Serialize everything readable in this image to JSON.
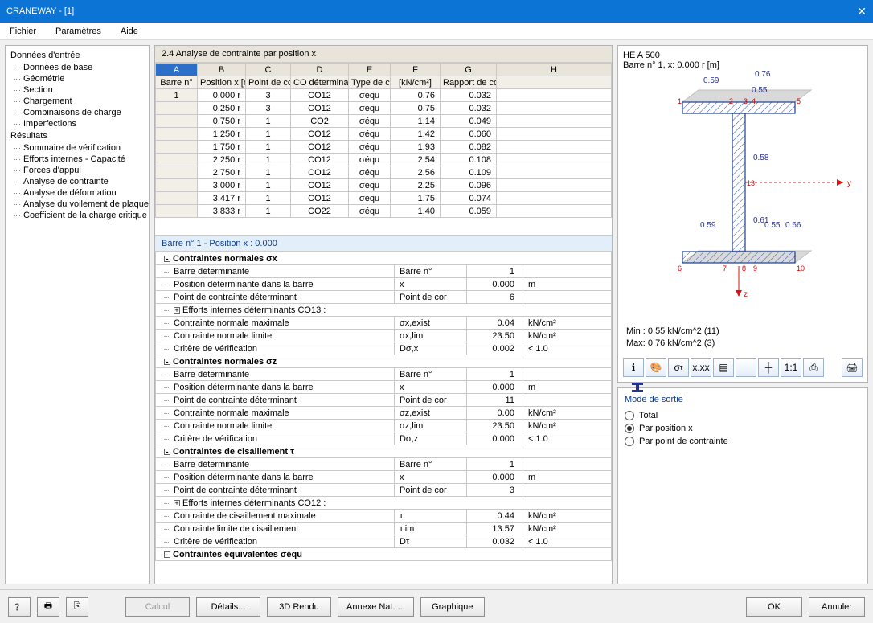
{
  "window": {
    "title": "CRANEWAY - [1]"
  },
  "menu": {
    "file": "Fichier",
    "params": "Paramètres",
    "help": "Aide"
  },
  "nav": {
    "cat_input": "Données d'entrée",
    "input_items": [
      "Données de base",
      "Géométrie",
      "Section",
      "Chargement",
      "Combinaisons de charge",
      "Imperfections"
    ],
    "cat_results": "Résultats",
    "result_items": [
      "Sommaire de vérification",
      "Efforts internes - Capacité",
      "Forces d'appui",
      "Analyse de contrainte",
      "Analyse de déformation",
      "Analyse du voilement de plaque",
      "Coefficient de la charge critique"
    ]
  },
  "panel": {
    "title": "2.4 Analyse de contrainte par position x"
  },
  "grid": {
    "letters": [
      "A",
      "B",
      "C",
      "D",
      "E",
      "F",
      "G",
      "H"
    ],
    "headers": [
      "Barre n°",
      "Position x [m]",
      "Point de contrainte",
      "CO déterminante",
      "Type de contrai",
      "[kN/cm²]",
      "Rapport de contraint",
      ""
    ],
    "rows": [
      {
        "a": "1",
        "b": "0.000 r",
        "c": "3",
        "d": "CO12",
        "e": "σéqu",
        "f": "0.76",
        "g": "0.032"
      },
      {
        "a": "",
        "b": "0.250 r",
        "c": "3",
        "d": "CO12",
        "e": "σéqu",
        "f": "0.75",
        "g": "0.032"
      },
      {
        "a": "",
        "b": "0.750 r",
        "c": "1",
        "d": "CO2",
        "e": "σéqu",
        "f": "1.14",
        "g": "0.049"
      },
      {
        "a": "",
        "b": "1.250 r",
        "c": "1",
        "d": "CO12",
        "e": "σéqu",
        "f": "1.42",
        "g": "0.060"
      },
      {
        "a": "",
        "b": "1.750 r",
        "c": "1",
        "d": "CO12",
        "e": "σéqu",
        "f": "1.93",
        "g": "0.082"
      },
      {
        "a": "",
        "b": "2.250 r",
        "c": "1",
        "d": "CO12",
        "e": "σéqu",
        "f": "2.54",
        "g": "0.108"
      },
      {
        "a": "",
        "b": "2.750 r",
        "c": "1",
        "d": "CO12",
        "e": "σéqu",
        "f": "2.56",
        "g": "0.109"
      },
      {
        "a": "",
        "b": "3.000 r",
        "c": "1",
        "d": "CO12",
        "e": "σéqu",
        "f": "2.25",
        "g": "0.096"
      },
      {
        "a": "",
        "b": "3.417 r",
        "c": "1",
        "d": "CO12",
        "e": "σéqu",
        "f": "1.75",
        "g": "0.074"
      },
      {
        "a": "",
        "b": "3.833 r",
        "c": "1",
        "d": "CO22",
        "e": "σéqu",
        "f": "1.40",
        "g": "0.059"
      }
    ]
  },
  "subheader": "Barre n°  1  -  Position x :  0.000",
  "details": [
    {
      "type": "group",
      "label": "Contraintes normales σx",
      "exp": "-"
    },
    {
      "label": "Barre déterminante",
      "sym": "Barre n°",
      "val": "1",
      "unit": ""
    },
    {
      "label": "Position déterminante dans la barre",
      "sym": "x",
      "val": "0.000",
      "unit": "m"
    },
    {
      "label": "Point de contrainte déterminant",
      "sym": "Point de cor",
      "val": "6",
      "unit": ""
    },
    {
      "type": "sub",
      "label": "Efforts internes déterminants CO13 :",
      "exp": "+"
    },
    {
      "label": "Contrainte normale maximale",
      "sym": "σx,exist",
      "val": "0.04",
      "unit": "kN/cm²"
    },
    {
      "label": "Contrainte normale limite",
      "sym": "σx,lim",
      "val": "23.50",
      "unit": "kN/cm²"
    },
    {
      "label": "Critère de vérification",
      "sym": "Dσ,x",
      "val": "0.002",
      "unit": "< 1.0"
    },
    {
      "type": "group",
      "label": "Contraintes normales σz",
      "exp": "-"
    },
    {
      "label": "Barre déterminante",
      "sym": "Barre n°",
      "val": "1",
      "unit": ""
    },
    {
      "label": "Position déterminante dans la barre",
      "sym": "x",
      "val": "0.000",
      "unit": "m"
    },
    {
      "label": "Point de contrainte déterminant",
      "sym": "Point de cor",
      "val": "11",
      "unit": ""
    },
    {
      "label": "Contrainte normale maximale",
      "sym": "σz,exist",
      "val": "0.00",
      "unit": "kN/cm²"
    },
    {
      "label": "Contrainte normale limite",
      "sym": "σz,lim",
      "val": "23.50",
      "unit": "kN/cm²"
    },
    {
      "label": "Critère de vérification",
      "sym": "Dσ,z",
      "val": "0.000",
      "unit": "< 1.0"
    },
    {
      "type": "group",
      "label": "Contraintes de cisaillement τ",
      "exp": "-"
    },
    {
      "label": "Barre déterminante",
      "sym": "Barre n°",
      "val": "1",
      "unit": ""
    },
    {
      "label": "Position déterminante dans la barre",
      "sym": "x",
      "val": "0.000",
      "unit": "m"
    },
    {
      "label": "Point de contrainte déterminant",
      "sym": "Point de cor",
      "val": "3",
      "unit": ""
    },
    {
      "type": "sub",
      "label": "Efforts internes déterminants CO12 :",
      "exp": "+"
    },
    {
      "label": "Contrainte de cisaillement maximale",
      "sym": "τ",
      "val": "0.44",
      "unit": "kN/cm²"
    },
    {
      "label": "Contrainte limite de cisaillement",
      "sym": "τlim",
      "val": "13.57",
      "unit": "kN/cm²"
    },
    {
      "label": "Critère de vérification",
      "sym": "Dτ",
      "val": "0.032",
      "unit": "< 1.0"
    },
    {
      "type": "group",
      "label": "Contraintes équivalentes σéqu",
      "exp": "-"
    }
  ],
  "preview": {
    "section_name": "HE A 500",
    "barre_info": "Barre n° 1, x: 0.000 r [m]",
    "min": "Min :    0.55  kN/cm^2 (11)",
    "max": "Max:    0.76  kN/cm^2 (3)",
    "annot": {
      "v1": "0.59",
      "v2": "0.76",
      "v3": "0.55",
      "v4": "0.58",
      "v5": "0.59",
      "v6": "0.61",
      "v7": "0.55",
      "v8": "0.66"
    }
  },
  "mode": {
    "title": "Mode de sortie",
    "opts": [
      "Total",
      "Par position x",
      "Par point de contrainte"
    ],
    "selected": 1
  },
  "footer": {
    "calc": "Calcul",
    "details": "Détails...",
    "render": "3D Rendu",
    "annex": "Annexe Nat. ...",
    "graph": "Graphique",
    "ok": "OK",
    "cancel": "Annuler"
  }
}
